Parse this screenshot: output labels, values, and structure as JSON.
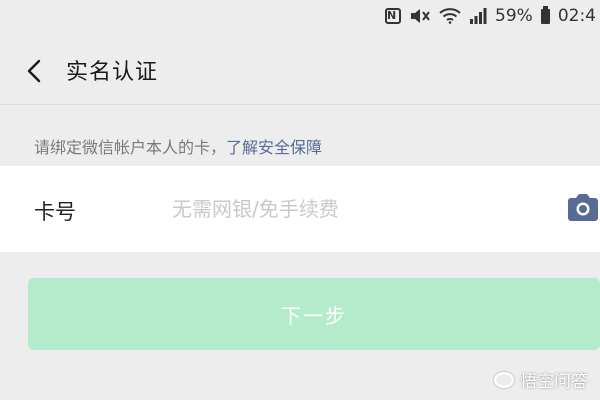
{
  "status_bar": {
    "nfc": "N",
    "battery": "59%",
    "time": "02:4"
  },
  "nav": {
    "title": "实名认证"
  },
  "hint": {
    "text": "请绑定微信帐户本人的卡，",
    "link": "了解安全保障"
  },
  "card": {
    "label": "卡号",
    "value": "",
    "placeholder": "无需网银/免手续费"
  },
  "next_button": {
    "label": "下一步"
  },
  "watermark": {
    "text": "悟空问答"
  },
  "colors": {
    "link": "#576b95",
    "button_disabled": "#b3ebcb",
    "background": "#ededed"
  },
  "icons": [
    "nfc-icon",
    "mute-icon",
    "wifi-icon",
    "signal-icon",
    "battery-icon",
    "back-icon",
    "camera-icon"
  ]
}
